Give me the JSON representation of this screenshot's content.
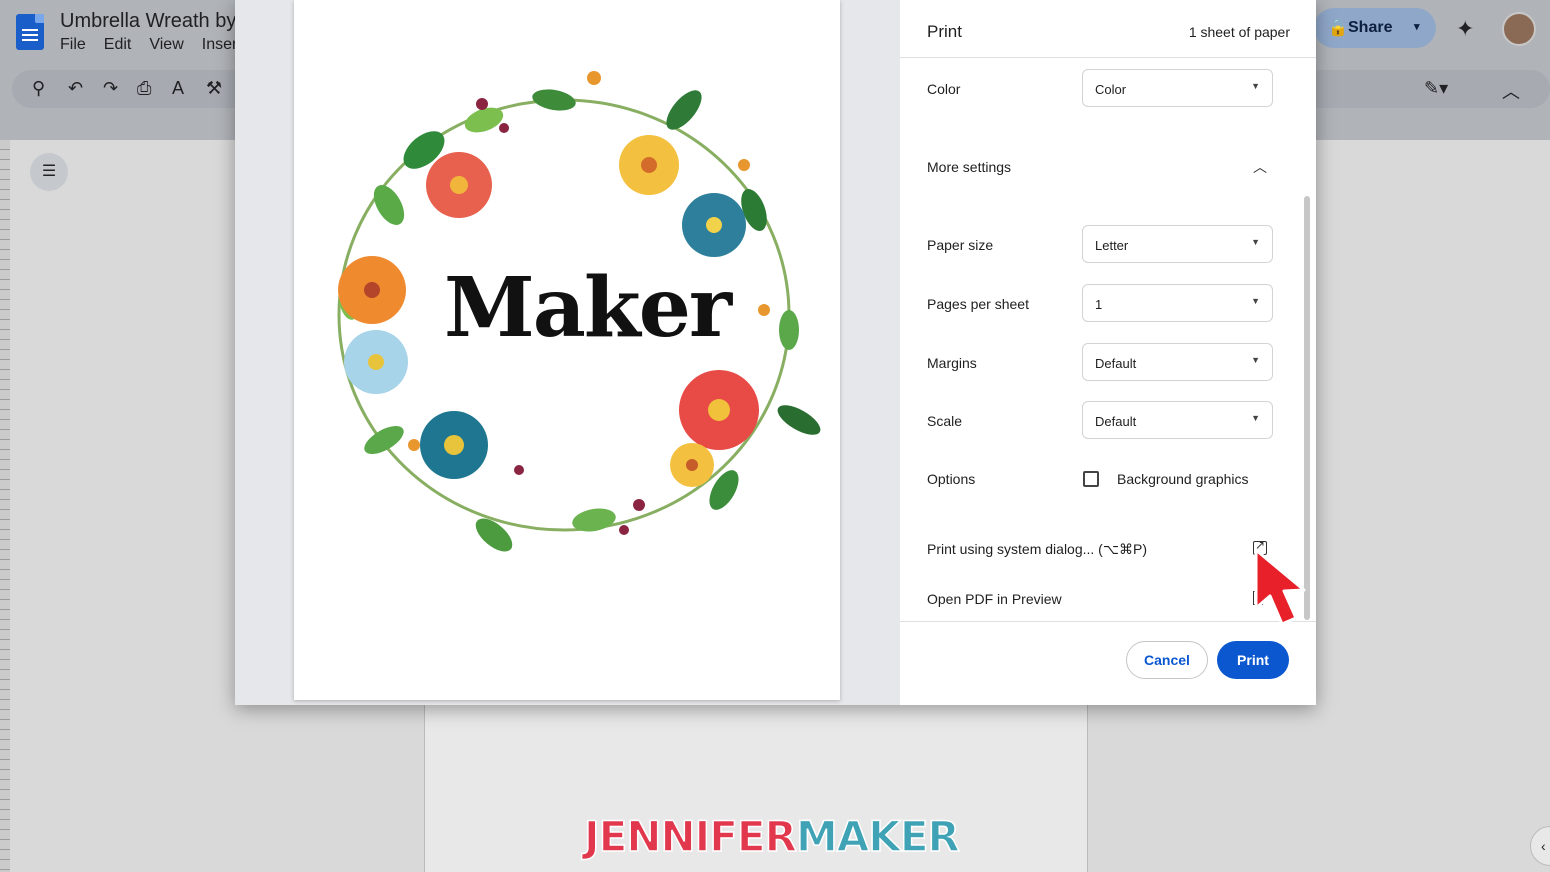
{
  "docs": {
    "title": "Umbrella Wreath by",
    "menu": [
      "File",
      "Edit",
      "View",
      "Inser"
    ],
    "share_label": "Share"
  },
  "print": {
    "title": "Print",
    "sheet_count": "1 sheet of paper",
    "color": {
      "label": "Color",
      "value": "Color"
    },
    "more_settings": "More settings",
    "paper_size": {
      "label": "Paper size",
      "value": "Letter"
    },
    "pages_per_sheet": {
      "label": "Pages per sheet",
      "value": "1"
    },
    "margins": {
      "label": "Margins",
      "value": "Default"
    },
    "scale": {
      "label": "Scale",
      "value": "Default"
    },
    "options": {
      "label": "Options",
      "checkbox_label": "Background graphics"
    },
    "system_dialog": "Print using system dialog... (⌥⌘P)",
    "open_pdf": "Open PDF in Preview",
    "cancel_label": "Cancel",
    "print_label": "Print"
  },
  "preview": {
    "text": "Maker"
  },
  "watermark": {
    "part1": "JENNIFER",
    "part2": "MAKER"
  },
  "colors": {
    "accent": "#0b57d0",
    "cursor": "#e8202a"
  }
}
